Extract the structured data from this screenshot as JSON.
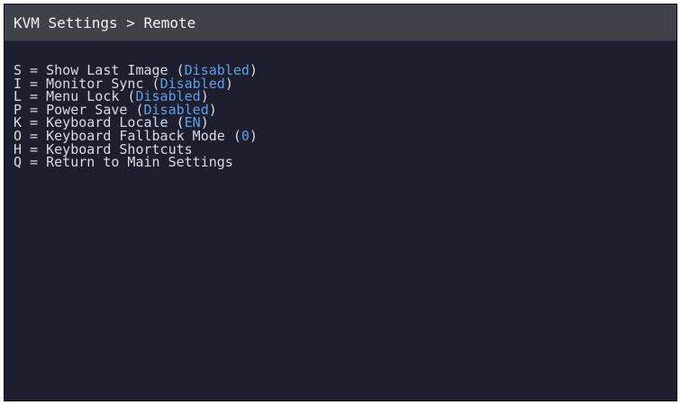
{
  "title": "KVM Settings > Remote",
  "colors": {
    "background": "#1d1f2f",
    "title_bar": "#40424a",
    "text": "#d9dbe2",
    "value": "#5f9fe6"
  },
  "menu": {
    "items": [
      {
        "key": "S",
        "sep": " = ",
        "label": "Show Last Image",
        "open": " (",
        "value": "Disabled",
        "close": ")"
      },
      {
        "key": "I",
        "sep": " = ",
        "label": "Monitor Sync",
        "open": " (",
        "value": "Disabled",
        "close": ")"
      },
      {
        "key": "L",
        "sep": " = ",
        "label": "Menu Lock",
        "open": " (",
        "value": "Disabled",
        "close": ")"
      },
      {
        "key": "P",
        "sep": " = ",
        "label": "Power Save",
        "open": " (",
        "value": "Disabled",
        "close": ")"
      },
      {
        "key": "K",
        "sep": " = ",
        "label": "Keyboard Locale",
        "open": " (",
        "value": "EN",
        "close": ")"
      },
      {
        "key": "O",
        "sep": " = ",
        "label": "Keyboard Fallback Mode",
        "open": " (",
        "value": "0",
        "close": ")"
      },
      {
        "key": "H",
        "sep": " = ",
        "label": "Keyboard Shortcuts"
      },
      {
        "key": "Q",
        "sep": " = ",
        "label": "Return to Main Settings"
      }
    ]
  }
}
